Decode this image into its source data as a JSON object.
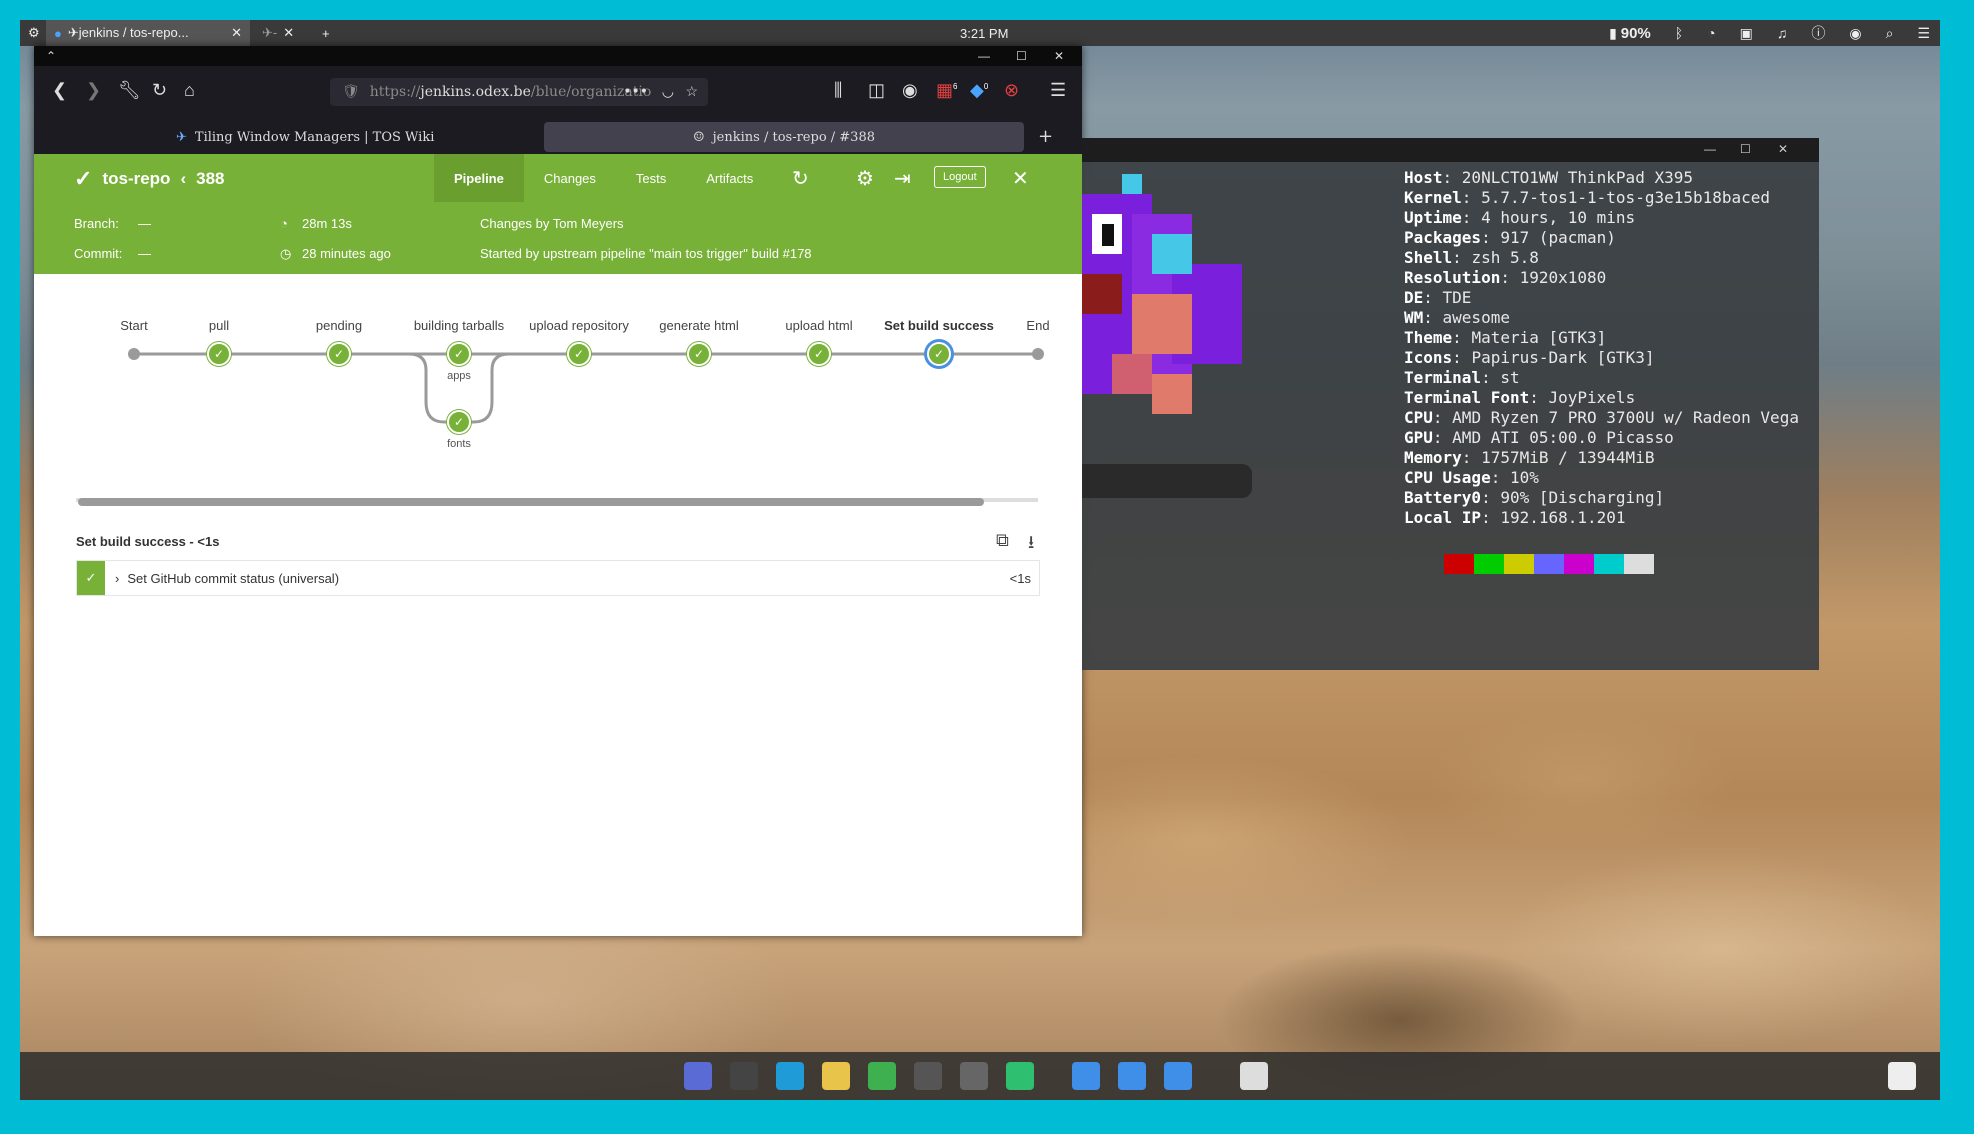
{
  "topbar": {
    "tab1": "✈jenkins / tos-repo...",
    "tab2": "✈-",
    "clock": "3:21 PM",
    "battery": "90%"
  },
  "browser": {
    "url_prefix": "https://",
    "url_host": "jenkins.odex.be",
    "url_path": "/blue/organizatio",
    "tabs": [
      {
        "label": "Tiling Window Managers | TOS Wiki"
      },
      {
        "label": "jenkins / tos-repo / #388"
      }
    ],
    "badge1": "6",
    "badge2": "0"
  },
  "jenkins": {
    "repo": "tos-repo",
    "build": "388",
    "tabs": [
      "Pipeline",
      "Changes",
      "Tests",
      "Artifacts"
    ],
    "logout": "Logout",
    "branch_label": "Branch:",
    "branch_value": "—",
    "commit_label": "Commit:",
    "commit_value": "—",
    "duration": "28m 13s",
    "ago": "28 minutes ago",
    "changes": "Changes by Tom Meyers",
    "started": "Started by upstream pipeline \"main tos trigger\" build #178",
    "stages": [
      "Start",
      "pull",
      "pending",
      "building tarballs",
      "upload repository",
      "generate html",
      "upload html",
      "Set build success",
      "End"
    ],
    "parallel": [
      "apps",
      "fonts"
    ],
    "step_heading": "Set build success - <1s",
    "step_name": "Set GitHub commit status (universal)",
    "step_time": "<1s"
  },
  "neofetch": [
    {
      "k": "Host",
      "v": "20NLCTO1WW ThinkPad X395"
    },
    {
      "k": "Kernel",
      "v": "5.7.7-tos1-1-tos-g3e15b18baced"
    },
    {
      "k": "Uptime",
      "v": "4 hours, 10 mins"
    },
    {
      "k": "Packages",
      "v": "917 (pacman)"
    },
    {
      "k": "Shell",
      "v": "zsh 5.8"
    },
    {
      "k": "Resolution",
      "v": "1920x1080"
    },
    {
      "k": "DE",
      "v": "TDE"
    },
    {
      "k": "WM",
      "v": "awesome"
    },
    {
      "k": "Theme",
      "v": "Materia [GTK3]"
    },
    {
      "k": "Icons",
      "v": "Papirus-Dark [GTK3]"
    },
    {
      "k": "Terminal",
      "v": "st"
    },
    {
      "k": "Terminal Font",
      "v": "JoyPixels"
    },
    {
      "k": "CPU",
      "v": "AMD Ryzen 7 PRO 3700U w/ Radeon Vega"
    },
    {
      "k": "GPU",
      "v": "AMD ATI 05:00.0 Picasso"
    },
    {
      "k": "Memory",
      "v": "1757MiB / 13944MiB"
    },
    {
      "k": "CPU Usage",
      "v": "10%"
    },
    {
      "k": "Battery0",
      "v": "90% [Discharging]"
    },
    {
      "k": "Local IP",
      "v": "192.168.1.201"
    }
  ],
  "swatches": [
    "#cc0000",
    "#00cc00",
    "#cccc00",
    "#6666ff",
    "#cc00cc",
    "#00cccc",
    "#dddddd"
  ],
  "colors": {
    "jenkins_green": "#78b138",
    "accent_blue": "#4a90e2",
    "desktop_border": "#00bcd4"
  },
  "dock_icons": [
    "compass-icon",
    "terminal-icon",
    "vscode-icon",
    "files-icon",
    "music-icon",
    "gamepad-icon",
    "avatar-icon",
    "image-viewer-icon",
    "home-folder-icon",
    "documents-folder-icon",
    "downloads-folder-icon",
    "recycle-icon",
    "layout-icon"
  ]
}
